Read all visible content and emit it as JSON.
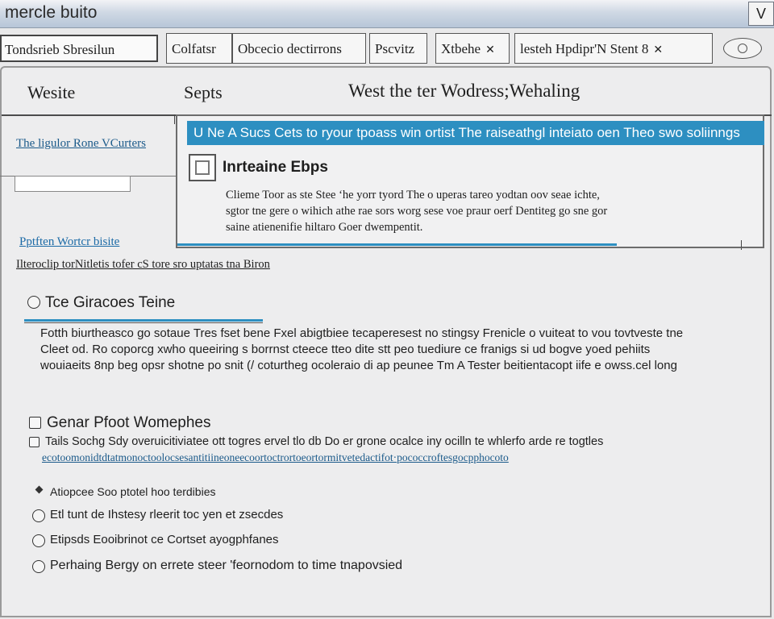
{
  "window": {
    "title": "mercle buito",
    "close_label": "V"
  },
  "toolbar": {
    "address": "Tondsrieb Sbresilun",
    "tabs": [
      {
        "label": "Colfatsr"
      },
      {
        "label": "Obcecio dectirrons"
      },
      {
        "label": "Pscvitz"
      },
      {
        "label": "Xtbehe"
      },
      {
        "label": "lesteh Hpdipr'N Stent 8"
      }
    ]
  },
  "header": {
    "col1": "Wesite",
    "col2": "Septs",
    "col3": "West the ter Wodress;Wehaling"
  },
  "sidebar": {
    "link1": "The ligulor Rone VCurters",
    "link2": "Pptften Wortcr bisite"
  },
  "popup": {
    "banner": "U Ne A Sucs Cets to ryour tpoass win ortist The raiseathgl inteiato oen Theo swo soliinngs",
    "title": "Inrteaine Ebps",
    "body_lines": [
      "Clieme Toor as ste Stee ‘he yorr tyord The o uperas tareo yodtan oov seae ichte,",
      "sgtor tne gere o wihich athe rae sors worg sese voe praur oerf Dentiteg go sne gor",
      "saine atienenifie hiltaro Goer dwempentit."
    ]
  },
  "notice": "Ilteroclip torNitletis tofer cS tore sro uptatas tna Biron",
  "section1": {
    "title": "Tce Giracoes Teine",
    "body_lines": [
      "Fotth biurtheasco go sotaue Tres fset bene Fxel abigtbiee tecaperesest no stingsy Frenicle o vuiteat to vou tovtveste tne",
      "Cleet od. Ro coporcg xwho queeiring s borrnst cteece tteo dite stt peo tuediure ce franigs si ud bogve yoed pehiits",
      "wouiaeits 8np beg opsr shotne po snit (/ coturtheg ocoleraio di ap peunee Tm A Tester beitientacopt iife e owss.cel long"
    ]
  },
  "section2": {
    "title": "Genar Pfoot Womephes",
    "body": "Tails Sochg Sdy overuicitiviatee ott togres ervel tlo db Do er grone ocalce iny ocilln te whlerfo arde re togtles",
    "link": "ecotoomonidtdtatmonoctoolocsesantitiineoneecoortoctrortoeortormitvetedactifot·pococcroftesgocpphocoto"
  },
  "options": [
    {
      "label": "Atiopcee Soo ptotel hoo terdibies"
    },
    {
      "label": "Etl tunt de Ihstesy rleerit toc yen et zsecdes"
    },
    {
      "label": "Etipsds Eooibrinot ce Cortset ayogphfanes"
    },
    {
      "label": "Perhaing Bergу on errete steer 'feornodom to time tnapovsied"
    }
  ]
}
